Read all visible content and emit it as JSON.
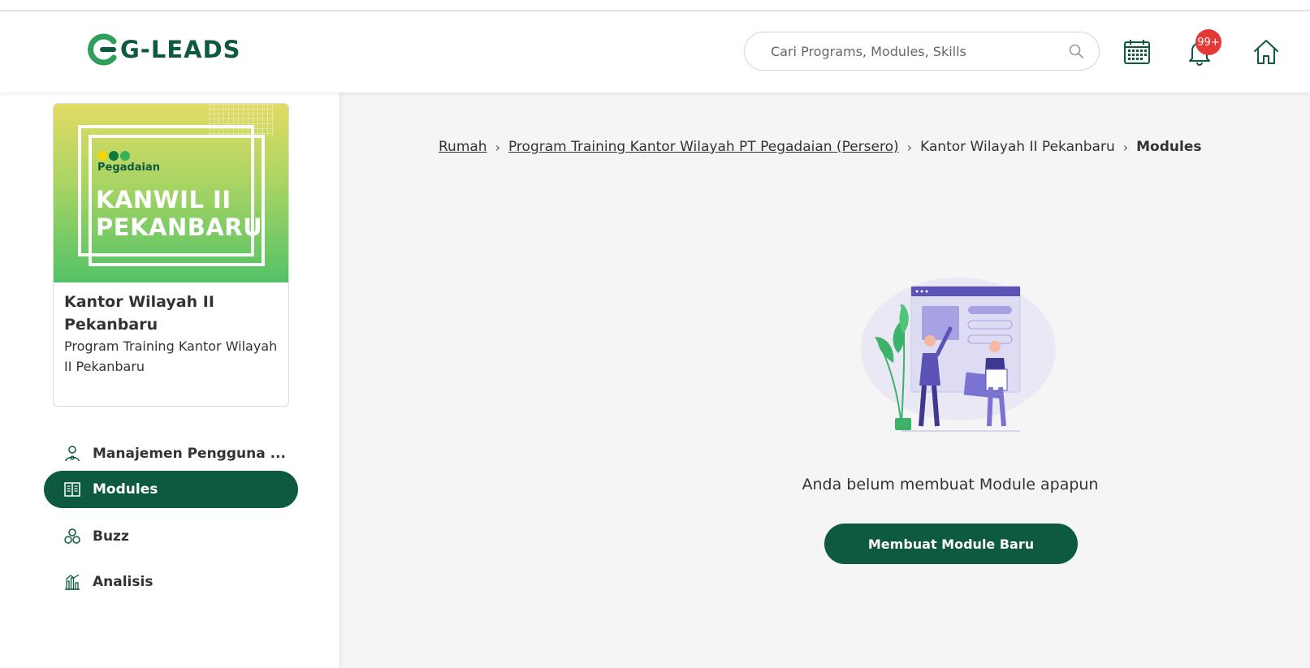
{
  "header": {
    "logo_text": "G-LEADS",
    "search_placeholder": "Cari Programs, Modules, Skills",
    "notification_count": "99+",
    "brand_color": "#0e5a40"
  },
  "sidebar": {
    "card": {
      "thumb_brand": "Pegadaian",
      "thumb_title_line1": "KANWIL II",
      "thumb_title_line2": "PEKANBARU",
      "title": "Kantor Wilayah II Pekanbaru",
      "subtitle": "Program Training Kantor Wilayah II Pekanbaru"
    },
    "items": [
      {
        "label": "Manajemen Pengguna ...",
        "icon": "user-gear-icon",
        "active": false
      },
      {
        "label": "Modules",
        "icon": "book-icon",
        "active": true
      },
      {
        "label": "Buzz",
        "icon": "people-icon",
        "active": false
      },
      {
        "label": "Analisis",
        "icon": "bar-chart-icon",
        "active": false
      }
    ]
  },
  "breadcrumb": {
    "items": [
      {
        "label": "Rumah",
        "link": true
      },
      {
        "label": "Program Training Kantor Wilayah PT Pegadaian (Persero)",
        "link": true
      },
      {
        "label": "Kantor Wilayah II Pekanbaru",
        "link": false
      },
      {
        "label": "Modules",
        "current": true
      }
    ]
  },
  "main": {
    "empty_message": "Anda belum membuat Module apapun",
    "cta_label": "Membuat Module Baru"
  }
}
